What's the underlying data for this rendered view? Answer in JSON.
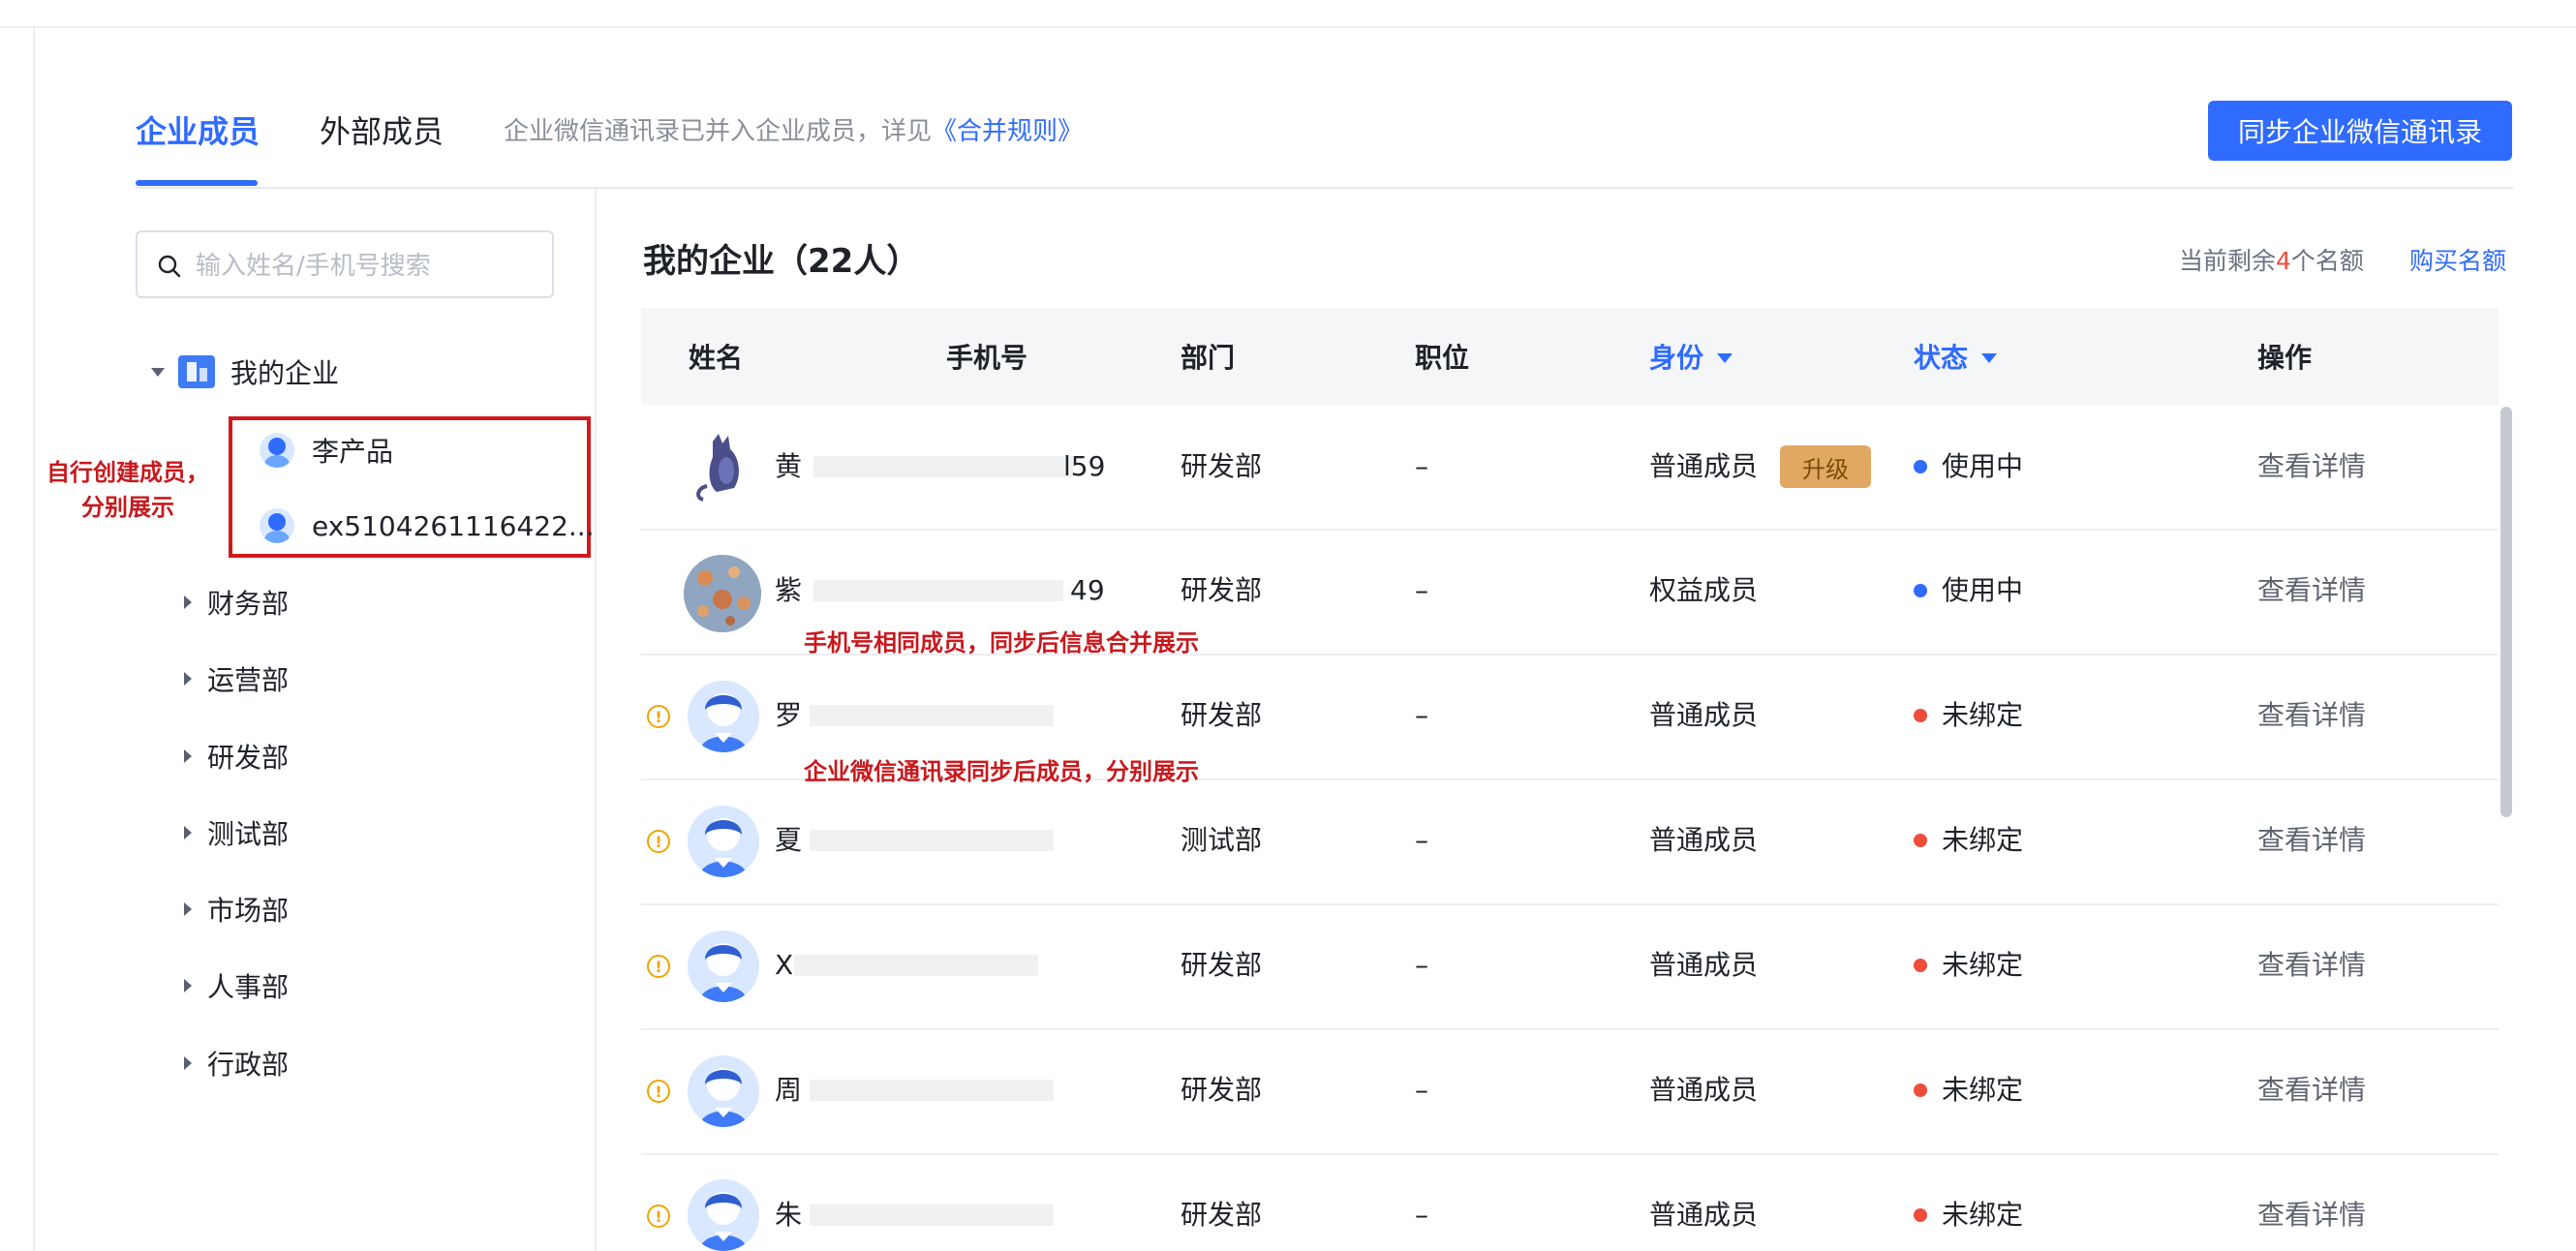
{
  "tabs": [
    {
      "label": "企业成员",
      "active": true
    },
    {
      "label": "外部成员",
      "active": false
    }
  ],
  "merge_note": {
    "text": "企业微信通讯录已并入企业成员，详见",
    "link": "《合并规则》"
  },
  "sync_button": "同步企业微信通讯录",
  "search": {
    "placeholder": "输入姓名/手机号搜索",
    "value": ""
  },
  "tree": {
    "root": "我的企业",
    "members": [
      "李产品",
      "ex5104261116422..."
    ],
    "departments": [
      "财务部",
      "运营部",
      "研发部",
      "测试部",
      "市场部",
      "人事部",
      "行政部"
    ]
  },
  "annotations": {
    "self_created_line1": "自行创建成员，",
    "self_created_line2": "分别展示",
    "same_phone": "手机号相同成员，同步后信息合并展示",
    "wecom_synced": "企业微信通讯录同步后成员，分别展示"
  },
  "main": {
    "title": "我的企业（22人）",
    "quota": {
      "prefix": "当前剩余",
      "count": "4",
      "suffix": "个名额"
    },
    "buy_link": "购买名额"
  },
  "table": {
    "columns": [
      "姓名",
      "手机号",
      "部门",
      "职位",
      "身份",
      "状态",
      "操作"
    ],
    "rows": [
      {
        "name": "黄",
        "phone": "l59",
        "department": "研发部",
        "position": "–",
        "role": "普通成员",
        "badge": "升级",
        "status": "使用中",
        "status_color": "#2f6bff",
        "action": "查看详情",
        "warning": false
      },
      {
        "name": "紫",
        "phone": "49",
        "department": "研发部",
        "position": "–",
        "role": "权益成员",
        "badge": "",
        "status": "使用中",
        "status_color": "#2f6bff",
        "action": "查看详情",
        "warning": false
      },
      {
        "name": "罗",
        "phone": "",
        "department": "研发部",
        "position": "–",
        "role": "普通成员",
        "badge": "",
        "status": "未绑定",
        "status_color": "#ee4d3c",
        "action": "查看详情",
        "warning": true
      },
      {
        "name": "夏",
        "phone": "",
        "department": "测试部",
        "position": "–",
        "role": "普通成员",
        "badge": "",
        "status": "未绑定",
        "status_color": "#ee4d3c",
        "action": "查看详情",
        "warning": true
      },
      {
        "name": "X",
        "phone": "",
        "department": "研发部",
        "position": "–",
        "role": "普通成员",
        "badge": "",
        "status": "未绑定",
        "status_color": "#ee4d3c",
        "action": "查看详情",
        "warning": true
      },
      {
        "name": "周",
        "phone": "",
        "department": "研发部",
        "position": "–",
        "role": "普通成员",
        "badge": "",
        "status": "未绑定",
        "status_color": "#ee4d3c",
        "action": "查看详情",
        "warning": true
      },
      {
        "name": "朱",
        "phone": "",
        "department": "研发部",
        "position": "–",
        "role": "普通成员",
        "badge": "",
        "status": "未绑定",
        "status_color": "#ee4d3c",
        "action": "查看详情",
        "warning": true
      }
    ]
  },
  "colors": {
    "accent": "#2f6bff",
    "annotation": "#c8191d",
    "warning": "#f0a500",
    "unbound": "#ee4d3c"
  }
}
